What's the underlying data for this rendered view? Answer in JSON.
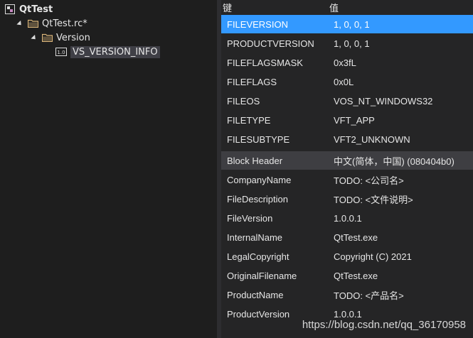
{
  "tree": {
    "root_label": "QtTest",
    "rc_file_label": "QtTest.rc*",
    "version_folder_label": "Version",
    "version_item_badge": "1.0",
    "version_item_label": "VS_VERSION_INFO"
  },
  "grid": {
    "header_key": "键",
    "header_value": "值",
    "fixed_rows": [
      {
        "key": "FILEVERSION",
        "value": "1, 0, 0, 1"
      },
      {
        "key": "PRODUCTVERSION",
        "value": "1, 0, 0, 1"
      },
      {
        "key": "FILEFLAGSMASK",
        "value": "0x3fL"
      },
      {
        "key": "FILEFLAGS",
        "value": "0x0L"
      },
      {
        "key": "FILEOS",
        "value": "VOS_NT_WINDOWS32"
      },
      {
        "key": "FILETYPE",
        "value": "VFT_APP"
      },
      {
        "key": "FILESUBTYPE",
        "value": "VFT2_UNKNOWN"
      }
    ],
    "block_row": {
      "key": "Block Header",
      "value": "中文(简体，中国) (080404b0)"
    },
    "string_rows": [
      {
        "key": "CompanyName",
        "value": "TODO: <公司名>"
      },
      {
        "key": "FileDescription",
        "value": "TODO: <文件说明>"
      },
      {
        "key": "FileVersion",
        "value": "1.0.0.1"
      },
      {
        "key": "InternalName",
        "value": "QtTest.exe"
      },
      {
        "key": "LegalCopyright",
        "value": "Copyright (C) 2021"
      },
      {
        "key": "OriginalFilename",
        "value": "QtTest.exe"
      },
      {
        "key": "ProductName",
        "value": "TODO: <产品名>"
      },
      {
        "key": "ProductVersion",
        "value": "1.0.0.1"
      }
    ]
  },
  "watermark": "https://blog.csdn.net/qq_36170958",
  "colors": {
    "selection": "#3399ff",
    "block_header_bg": "#3e3e42",
    "background": "#1e1e1e"
  }
}
